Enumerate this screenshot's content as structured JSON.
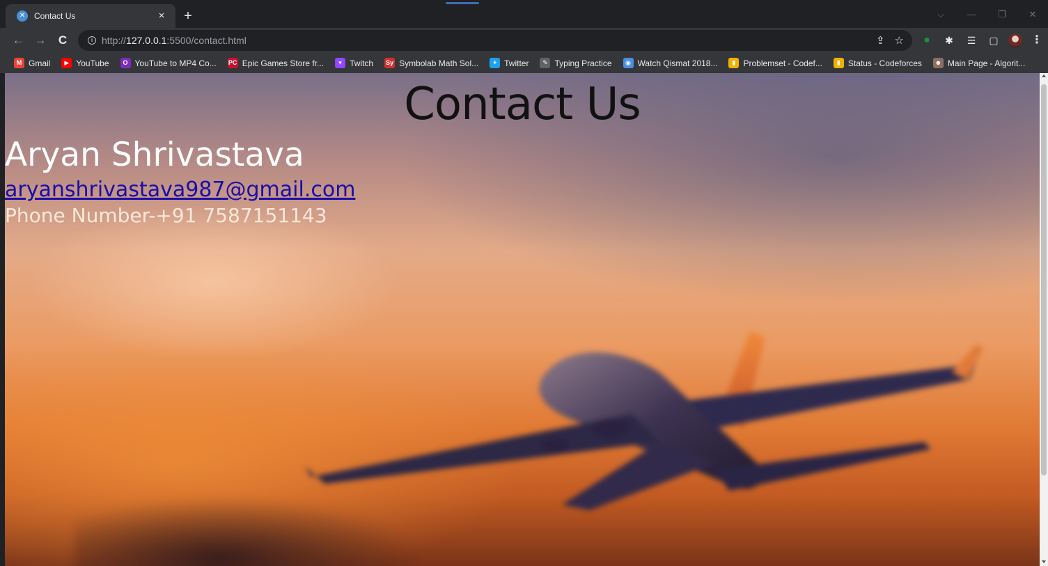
{
  "tab": {
    "title": "Contact Us",
    "close": "×",
    "new_tab": "+"
  },
  "window_controls": {
    "dropdown": "⌵",
    "minimize": "—",
    "restore": "❐",
    "close": "✕"
  },
  "toolbar": {
    "back": "←",
    "forward": "→",
    "reload": "C",
    "url_scheme": "http://",
    "url_host": "127.0.0.1",
    "url_rest": ":5500/contact.html",
    "share": "⇪",
    "star": "☆"
  },
  "extensions": {
    "ext1": "●",
    "puzzle": "✱",
    "reading_list": "☰",
    "side_panel": "▢",
    "menu": "⋮"
  },
  "bookmarks": [
    {
      "label": "Gmail",
      "icon": "M",
      "color": "#ea4335"
    },
    {
      "label": "YouTube",
      "icon": "▶",
      "color": "#ff0000"
    },
    {
      "label": "YouTube to MP4 Co...",
      "icon": "O",
      "color": "#7b2cbf"
    },
    {
      "label": "Epic Games Store fr...",
      "icon": "PC",
      "color": "#c8102e"
    },
    {
      "label": "Twitch",
      "icon": "▾",
      "color": "#9146ff"
    },
    {
      "label": "Symbolab Math Sol...",
      "icon": "Sy",
      "color": "#d32f2f"
    },
    {
      "label": "Twitter",
      "icon": "✦",
      "color": "#1da1f2"
    },
    {
      "label": "Typing Practice",
      "icon": "✎",
      "color": "#5f6368"
    },
    {
      "label": "Watch Qismat 2018...",
      "icon": "◉",
      "color": "#4a90e2"
    },
    {
      "label": "Problemset - Codef...",
      "icon": "▮",
      "color": "#f2b100"
    },
    {
      "label": "Status - Codeforces",
      "icon": "▮",
      "color": "#f2b100"
    },
    {
      "label": "Main Page - Algorit...",
      "icon": "☻",
      "color": "#8d6e63"
    }
  ],
  "page": {
    "title": "Contact Us",
    "name": "Aryan Shrivastava",
    "email": "aryanshrivastava987@gmail.com",
    "phone": "Phone Number-+91 7587151143"
  }
}
